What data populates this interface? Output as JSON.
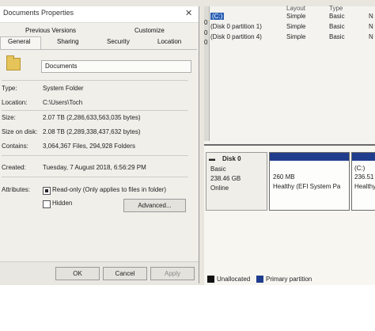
{
  "dialog": {
    "title": "Documents Properties",
    "close_glyph": "✕",
    "tabs_row1": [
      "Previous Versions",
      "Customize"
    ],
    "tabs_row2": [
      "General",
      "Sharing",
      "Security",
      "Location"
    ],
    "folder_name": "Documents",
    "fields": {
      "type_label": "Type:",
      "type_value": "System Folder",
      "location_label": "Location:",
      "location_value": "C:\\Users\\Toch",
      "size_label": "Size:",
      "size_value": "2.07 TB (2,286,633,563,035 bytes)",
      "size_on_disk_label": "Size on disk:",
      "size_on_disk_value": "2.08 TB (2,289,338,437,632 bytes)",
      "contains_label": "Contains:",
      "contains_value": "3,064,367 Files, 294,928 Folders",
      "created_label": "Created:",
      "created_value": "Tuesday, 7 August 2018, 6:56:29 PM",
      "attributes_label": "Attributes:",
      "readonly_label": "Read-only (Only applies to files in folder)",
      "hidden_label": "Hidden",
      "advanced_label": "Advanced..."
    },
    "buttons": {
      "ok": "OK",
      "cancel": "Cancel",
      "apply": "Apply"
    }
  },
  "disk_management": {
    "column_headers": [
      "Layout",
      "Type"
    ],
    "volumes": [
      {
        "name": "(C:)",
        "layout": "Simple",
        "type": "Basic",
        "fs": "N"
      },
      {
        "name": "(Disk 0 partition 1)",
        "layout": "Simple",
        "type": "Basic",
        "fs": "N"
      },
      {
        "name": "(Disk 0 partition 4)",
        "layout": "Simple",
        "type": "Basic",
        "fs": "N"
      }
    ],
    "left_marks": [
      "0",
      "0",
      "0"
    ],
    "disk": {
      "name": "Disk 0",
      "kind": "Basic",
      "size": "238.46 GB",
      "status": "Online"
    },
    "partitions": [
      {
        "size": "260 MB",
        "status": "Healthy (EFI System Pa"
      },
      {
        "label": "(C:)",
        "size": "236.51",
        "status": "Healthy"
      }
    ],
    "legend": {
      "unallocated": "Unallocated",
      "primary": "Primary partition"
    },
    "colors": {
      "primary": "#1f3d8c",
      "selected": "#2a5fb4"
    }
  }
}
